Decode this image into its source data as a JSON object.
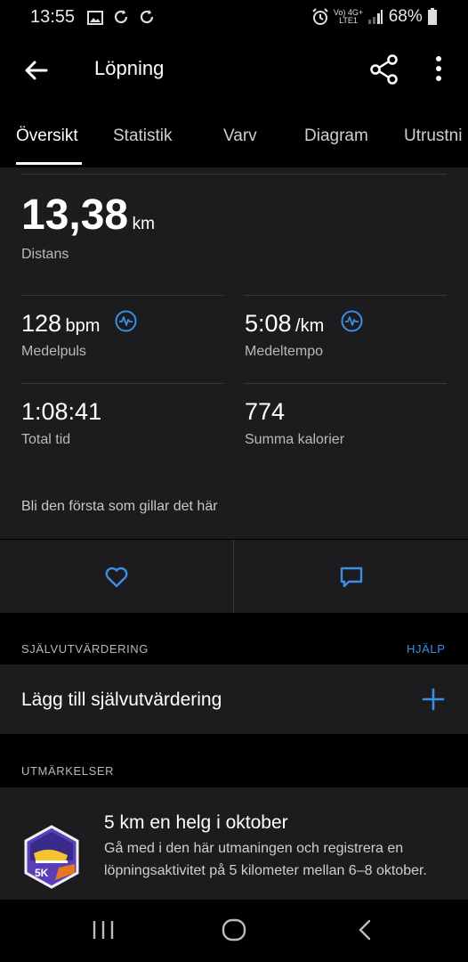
{
  "status_bar": {
    "time": "13:55",
    "network_line1": "Vo) 4G+",
    "network_line2": "LTE1",
    "battery": "68%"
  },
  "app_bar": {
    "title": "Löpning"
  },
  "tabs": [
    {
      "label": "Översikt",
      "active": true
    },
    {
      "label": "Statistik",
      "active": false
    },
    {
      "label": "Varv",
      "active": false
    },
    {
      "label": "Diagram",
      "active": false
    },
    {
      "label": "Utrustni",
      "active": false
    }
  ],
  "summary": {
    "distance_value": "13,38",
    "distance_unit": "km",
    "distance_label": "Distans",
    "hr_value": "128",
    "hr_unit": "bpm",
    "hr_label": "Medelpuls",
    "pace_value": "5:08",
    "pace_unit": "/km",
    "pace_label": "Medeltempo",
    "time_value": "1:08:41",
    "time_label": "Total tid",
    "cal_value": "774",
    "cal_label": "Summa kalorier"
  },
  "likes_text": "Bli den första som gillar det här",
  "self_eval": {
    "header": "SJÄLVUTVÄRDERING",
    "help": "HJÄLP",
    "add_label": "Lägg till självutvärdering"
  },
  "badges": {
    "header": "UTMÄRKELSER",
    "title": "5 km en helg i oktober",
    "description": "Gå med i den här utmaningen och registrera en löpningsaktivitet på 5 kilometer mellan 6–8 oktober.",
    "badge_text": "5K"
  },
  "colors": {
    "accent": "#3a8ee6",
    "panel": "#1c1c1e",
    "background": "#000000"
  }
}
